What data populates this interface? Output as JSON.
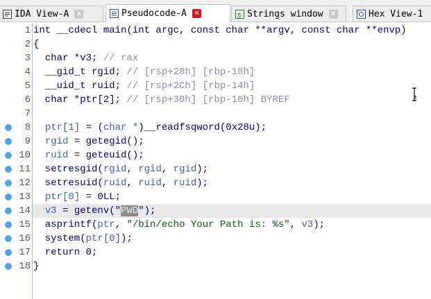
{
  "tabs": [
    {
      "label": "IDA View-A",
      "icon": "disassembly-icon",
      "active": false,
      "close": "grey"
    },
    {
      "label": "Pseudocode-A",
      "icon": "pseudocode-icon",
      "active": true,
      "close": "red"
    },
    {
      "label": "Strings window",
      "icon": "strings-icon",
      "active": false,
      "close": "grey"
    },
    {
      "label": "Hex View-1",
      "icon": "hex-icon",
      "active": false,
      "close": "none"
    }
  ],
  "close_glyph": "✕",
  "colors": {
    "code": "#000080",
    "comment": "#8a8ab8",
    "string": "#006400",
    "breakpoint_dot": "#4ba6e8",
    "close_active": "#e01010",
    "highlight_line": "#e8e8e8"
  },
  "code": {
    "lines": [
      {
        "num": "1",
        "dot": false,
        "highlight": false,
        "tokens": [
          {
            "t": "int __cdecl main(int argc, const char **argv, const char **envp)",
            "c": "plain"
          }
        ]
      },
      {
        "num": "2",
        "dot": false,
        "highlight": false,
        "tokens": [
          {
            "t": "{",
            "c": "plain"
          }
        ]
      },
      {
        "num": "3",
        "dot": false,
        "highlight": false,
        "tokens": [
          {
            "t": "  char *v3; ",
            "c": "plain"
          },
          {
            "t": "// rax",
            "c": "comment"
          }
        ]
      },
      {
        "num": "4",
        "dot": false,
        "highlight": false,
        "tokens": [
          {
            "t": "  __gid_t rgid; ",
            "c": "plain"
          },
          {
            "t": "// [rsp+28h] [rbp-18h]",
            "c": "comment"
          }
        ]
      },
      {
        "num": "5",
        "dot": false,
        "highlight": false,
        "tokens": [
          {
            "t": "  __uid_t ruid; ",
            "c": "plain"
          },
          {
            "t": "// [rsp+2Ch] [rbp-14h]",
            "c": "comment"
          }
        ]
      },
      {
        "num": "6",
        "dot": false,
        "highlight": false,
        "tokens": [
          {
            "t": "  char *ptr[2]; ",
            "c": "plain"
          },
          {
            "t": "// [rsp+30h] [rbp-10h] BYREF",
            "c": "comment"
          }
        ]
      },
      {
        "num": "7",
        "dot": false,
        "highlight": false,
        "tokens": []
      },
      {
        "num": "8",
        "dot": true,
        "highlight": false,
        "tokens": [
          {
            "t": "  ",
            "c": "plain"
          },
          {
            "t": "ptr[1]",
            "c": "var"
          },
          {
            "t": " = (",
            "c": "plain"
          },
          {
            "t": "char *",
            "c": "var"
          },
          {
            "t": ")__readfsqword(0x28u);",
            "c": "plain"
          }
        ]
      },
      {
        "num": "9",
        "dot": true,
        "highlight": false,
        "tokens": [
          {
            "t": "  ",
            "c": "plain"
          },
          {
            "t": "rgid",
            "c": "var"
          },
          {
            "t": " = getegid();",
            "c": "plain"
          }
        ]
      },
      {
        "num": "10",
        "dot": true,
        "highlight": false,
        "tokens": [
          {
            "t": "  ",
            "c": "plain"
          },
          {
            "t": "ruid",
            "c": "var"
          },
          {
            "t": " = geteuid();",
            "c": "plain"
          }
        ]
      },
      {
        "num": "11",
        "dot": true,
        "highlight": false,
        "tokens": [
          {
            "t": "  setresgid(",
            "c": "plain"
          },
          {
            "t": "rgid",
            "c": "var"
          },
          {
            "t": ", ",
            "c": "plain"
          },
          {
            "t": "rgid",
            "c": "var"
          },
          {
            "t": ", ",
            "c": "plain"
          },
          {
            "t": "rgid",
            "c": "var"
          },
          {
            "t": ");",
            "c": "plain"
          }
        ]
      },
      {
        "num": "12",
        "dot": true,
        "highlight": false,
        "tokens": [
          {
            "t": "  setresuid(",
            "c": "plain"
          },
          {
            "t": "ruid",
            "c": "var"
          },
          {
            "t": ", ",
            "c": "plain"
          },
          {
            "t": "ruid",
            "c": "var"
          },
          {
            "t": ", ",
            "c": "plain"
          },
          {
            "t": "ruid",
            "c": "var"
          },
          {
            "t": ");",
            "c": "plain"
          }
        ]
      },
      {
        "num": "13",
        "dot": true,
        "highlight": false,
        "tokens": [
          {
            "t": "  ",
            "c": "plain"
          },
          {
            "t": "ptr[0]",
            "c": "var"
          },
          {
            "t": " = 0LL;",
            "c": "plain"
          }
        ]
      },
      {
        "num": "14",
        "dot": true,
        "highlight": true,
        "tokens": [
          {
            "t": "  ",
            "c": "plain"
          },
          {
            "t": "v3",
            "c": "var"
          },
          {
            "t": " = getenv(\"",
            "c": "plain"
          },
          {
            "t": "PWD",
            "c": "sel"
          },
          {
            "t": "\");",
            "c": "plain"
          }
        ]
      },
      {
        "num": "15",
        "dot": true,
        "highlight": false,
        "tokens": [
          {
            "t": "  asprintf(",
            "c": "plain"
          },
          {
            "t": "ptr",
            "c": "var"
          },
          {
            "t": ", ",
            "c": "plain"
          },
          {
            "t": "\"/bin/echo Your Path is: %s\"",
            "c": "string"
          },
          {
            "t": ", ",
            "c": "plain"
          },
          {
            "t": "v3",
            "c": "var"
          },
          {
            "t": ");",
            "c": "plain"
          }
        ]
      },
      {
        "num": "16",
        "dot": true,
        "highlight": false,
        "tokens": [
          {
            "t": "  system(",
            "c": "plain"
          },
          {
            "t": "ptr[0]",
            "c": "var"
          },
          {
            "t": ");",
            "c": "plain"
          }
        ]
      },
      {
        "num": "17",
        "dot": true,
        "highlight": false,
        "tokens": [
          {
            "t": "  return 0;",
            "c": "plain"
          }
        ]
      },
      {
        "num": "18",
        "dot": true,
        "highlight": false,
        "tokens": [
          {
            "t": "}",
            "c": "plain"
          }
        ]
      }
    ]
  }
}
